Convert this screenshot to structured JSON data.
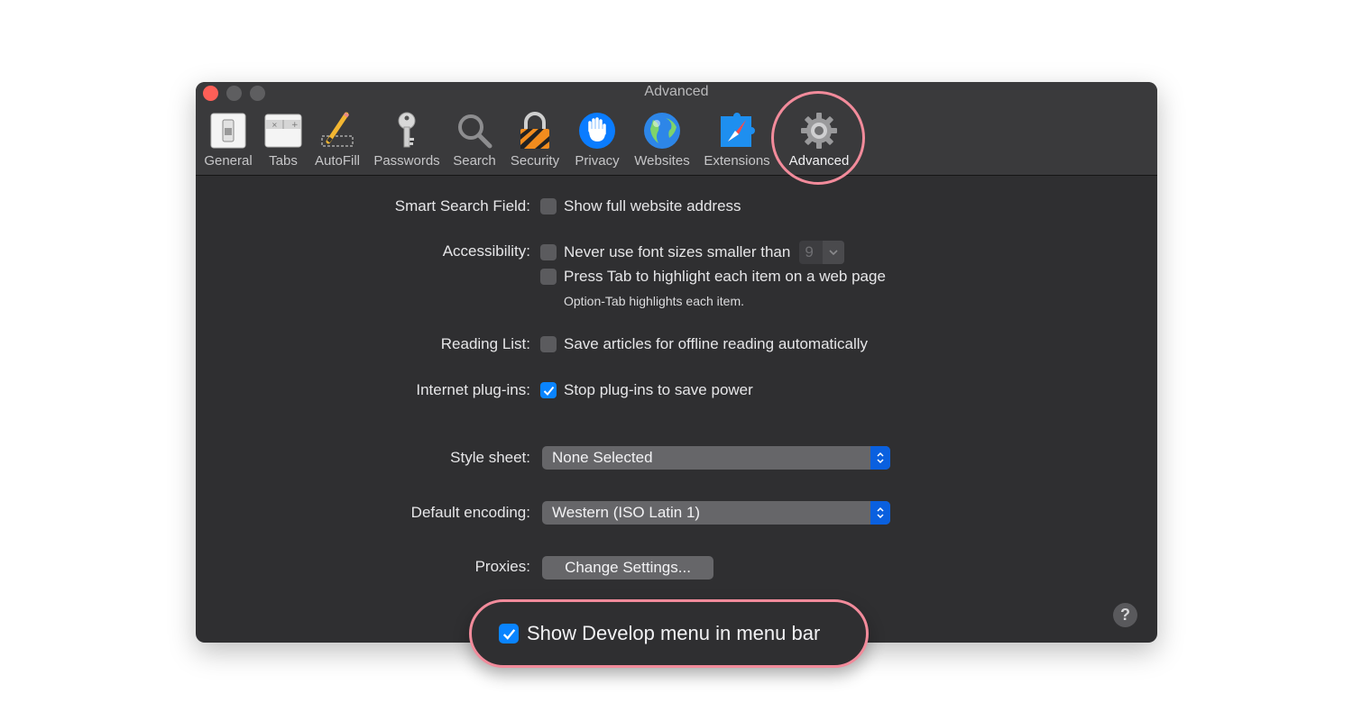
{
  "window": {
    "title": "Advanced"
  },
  "toolbar": {
    "tabs": [
      {
        "label": "General",
        "icon": "general-switch-icon"
      },
      {
        "label": "Tabs",
        "icon": "tabs-window-icon"
      },
      {
        "label": "AutoFill",
        "icon": "pencil-icon"
      },
      {
        "label": "Passwords",
        "icon": "key-icon"
      },
      {
        "label": "Search",
        "icon": "magnifier-icon"
      },
      {
        "label": "Security",
        "icon": "padlock-icon"
      },
      {
        "label": "Privacy",
        "icon": "hand-icon"
      },
      {
        "label": "Websites",
        "icon": "globe-icon"
      },
      {
        "label": "Extensions",
        "icon": "puzzle-compass-icon"
      },
      {
        "label": "Advanced",
        "icon": "gear-icon",
        "active": true
      }
    ]
  },
  "settings": {
    "smart_search": {
      "label": "Smart Search Field:",
      "option": "Show full website address",
      "checked": false
    },
    "accessibility": {
      "label": "Accessibility:",
      "option1": "Never use font sizes smaller than",
      "option1_checked": false,
      "font_size": "9",
      "option2": "Press Tab to highlight each item on a web page",
      "option2_checked": false,
      "hint": "Option-Tab highlights each item."
    },
    "reading_list": {
      "label": "Reading List:",
      "option": "Save articles for offline reading automatically",
      "checked": false
    },
    "plugins": {
      "label": "Internet plug-ins:",
      "option": "Stop plug-ins to save power",
      "checked": true
    },
    "style_sheet": {
      "label": "Style sheet:",
      "value": "None Selected"
    },
    "encoding": {
      "label": "Default encoding:",
      "value": "Western (ISO Latin 1)"
    },
    "proxies": {
      "label": "Proxies:",
      "button": "Change Settings..."
    },
    "develop": {
      "option": "Show Develop menu in menu bar",
      "checked": true
    }
  },
  "help": {
    "symbol": "?"
  },
  "colors": {
    "accent": "#0a84ff",
    "highlight_ring": "#f28b9b",
    "window_bg": "#2f2f31"
  }
}
